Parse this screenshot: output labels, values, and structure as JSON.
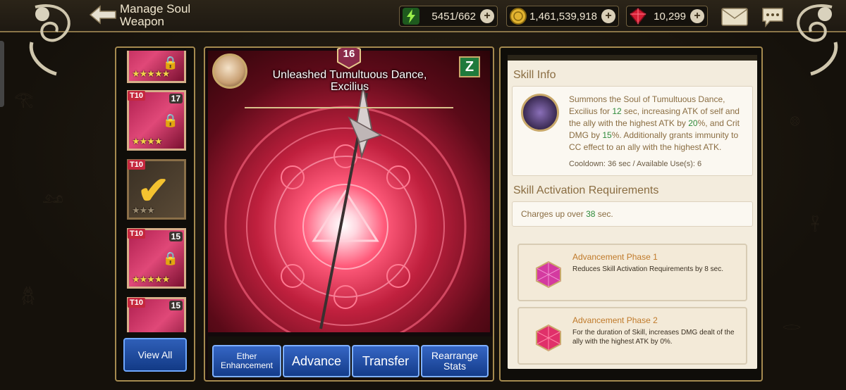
{
  "header": {
    "title": "Manage Soul Weapon",
    "stamina": "5451/662",
    "gold": "1,461,539,918",
    "gems": "10,299"
  },
  "inventory": {
    "cards": [
      {
        "tier": "",
        "level": "",
        "stars": "★★★★★",
        "locked": true,
        "style": "pink"
      },
      {
        "tier": "T10",
        "level": "17",
        "stars": "★★★★",
        "locked": true,
        "style": "pink"
      },
      {
        "tier": "T10",
        "level": "",
        "stars": "★★★",
        "locked": false,
        "style": "gold",
        "selected": true
      },
      {
        "tier": "T10",
        "level": "15",
        "stars": "★★★★★",
        "locked": true,
        "style": "pink"
      },
      {
        "tier": "T10",
        "level": "15",
        "stars": "★★★★★",
        "locked": false,
        "style": "pink"
      }
    ],
    "view_all_label": "View All"
  },
  "weapon": {
    "level": "16",
    "name_line1": "Unleashed Tumultuous Dance,",
    "name_line2": "Excilius",
    "badge_letter": "Z"
  },
  "actions": {
    "ether_line1": "Ether",
    "ether_line2": "Enhancement",
    "advance": "Advance",
    "transfer": "Transfer",
    "rearrange_line1": "Rearrange",
    "rearrange_line2": "Stats"
  },
  "skill_info": {
    "title": "Skill Info",
    "desc_a": "Summons the Soul of Tumultuous Dance, Excilius for ",
    "desc_sec": "12",
    "desc_b": " sec, increasing ATK of self and the ally with the highest ATK by ",
    "desc_atk": "20",
    "desc_c": "%, and Crit DMG by ",
    "desc_crit": "15",
    "desc_d": "%. Additionally grants immunity to CC effect to an ally with the highest ATK.",
    "cooldown": "Cooldown: 36 sec / Available Use(s): 6"
  },
  "activation": {
    "title": "Skill Activation Requirements",
    "prefix": "Charges up over ",
    "seconds": "38",
    "suffix": " sec."
  },
  "advancement": [
    {
      "phase": "Advancement Phase 1",
      "effect": "Reduces Skill Activation Requirements by 8 sec."
    },
    {
      "phase": "Advancement Phase 2",
      "effect": "For the duration of Skill, increases DMG dealt of the ally with the highest ATK by 0%."
    }
  ]
}
